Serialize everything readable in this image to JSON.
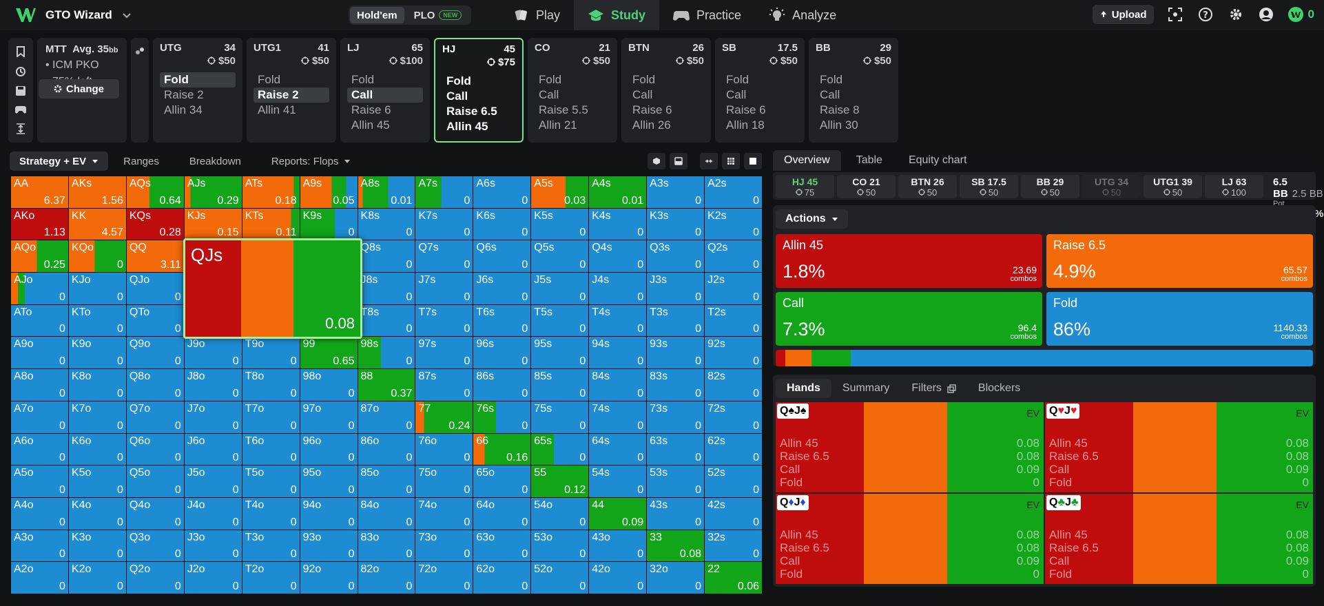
{
  "app": {
    "brand": "GTO Wizard"
  },
  "variant": {
    "holdem": "Hold'em",
    "plo": "PLO",
    "plo_badge": "NEW"
  },
  "nav": {
    "play": "Play",
    "study": "Study",
    "practice": "Practice",
    "analyze": "Analyze"
  },
  "top": {
    "upload": "Upload",
    "credits": "0"
  },
  "format": {
    "title": "MTT",
    "avg": "Avg. 35",
    "avg_unit": "bb",
    "line1": "• ICM PKO",
    "line2": "• 75% left",
    "change": "Change"
  },
  "seats": [
    {
      "pos": "UTG",
      "stack": "34",
      "bounty": "$50",
      "actions": [
        {
          "label": "Fold",
          "sel": true
        },
        {
          "label": "Raise 2",
          "sel": false
        },
        {
          "label": "Allin 34",
          "sel": false
        }
      ]
    },
    {
      "pos": "UTG1",
      "stack": "41",
      "bounty": "$50",
      "actions": [
        {
          "label": "Fold",
          "sel": false
        },
        {
          "label": "Raise 2",
          "sel": true
        },
        {
          "label": "Allin 41",
          "sel": false
        }
      ]
    },
    {
      "pos": "LJ",
      "stack": "65",
      "bounty": "$100",
      "actions": [
        {
          "label": "Fold",
          "sel": false
        },
        {
          "label": "Call",
          "sel": true
        },
        {
          "label": "Raise 6",
          "sel": false
        },
        {
          "label": "Allin 45",
          "sel": false
        }
      ]
    },
    {
      "pos": "HJ",
      "stack": "45",
      "bounty": "$75",
      "active": true,
      "actions": [
        {
          "label": "Fold",
          "sel": false
        },
        {
          "label": "Call",
          "sel": false
        },
        {
          "label": "Raise 6.5",
          "sel": false
        },
        {
          "label": "Allin 45",
          "sel": false
        }
      ]
    },
    {
      "pos": "CO",
      "stack": "21",
      "bounty": "$50",
      "actions": [
        {
          "label": "Fold",
          "sel": false
        },
        {
          "label": "Call",
          "sel": false
        },
        {
          "label": "Raise 5.5",
          "sel": false
        },
        {
          "label": "Allin 21",
          "sel": false
        }
      ]
    },
    {
      "pos": "BTN",
      "stack": "26",
      "bounty": "$50",
      "actions": [
        {
          "label": "Fold",
          "sel": false
        },
        {
          "label": "Call",
          "sel": false
        },
        {
          "label": "Raise 6",
          "sel": false
        },
        {
          "label": "Allin 26",
          "sel": false
        }
      ]
    },
    {
      "pos": "SB",
      "stack": "17.5",
      "bounty": "$50",
      "actions": [
        {
          "label": "Fold",
          "sel": false
        },
        {
          "label": "Call",
          "sel": false
        },
        {
          "label": "Raise 6",
          "sel": false
        },
        {
          "label": "Allin 18",
          "sel": false
        }
      ]
    },
    {
      "pos": "BB",
      "stack": "29",
      "bounty": "$50",
      "actions": [
        {
          "label": "Fold",
          "sel": false
        },
        {
          "label": "Call",
          "sel": false
        },
        {
          "label": "Raise 8",
          "sel": false
        },
        {
          "label": "Allin 30",
          "sel": false
        }
      ]
    }
  ],
  "left_tabs": {
    "strategy": "Strategy + EV",
    "ranges": "Ranges",
    "breakdown": "Breakdown",
    "reports": "Reports: Flops"
  },
  "colors": {
    "allin": "#bf0d0d",
    "raise": "#f26a0a",
    "call": "#12a51a",
    "fold": "#1e8cd2"
  },
  "grid": {
    "hands": [
      [
        "AA",
        "AKs",
        "AQs",
        "AJs",
        "ATs",
        "A9s",
        "A8s",
        "A7s",
        "A6s",
        "A5s",
        "A4s",
        "A3s",
        "A2s"
      ],
      [
        "AKo",
        "KK",
        "KQs",
        "KJs",
        "KTs",
        "K9s",
        "K8s",
        "K7s",
        "K6s",
        "K5s",
        "K4s",
        "K3s",
        "K2s"
      ],
      [
        "AQo",
        "KQo",
        "QQ",
        "QJs",
        "QTs",
        "Q9s",
        "Q8s",
        "Q7s",
        "Q6s",
        "Q5s",
        "Q4s",
        "Q3s",
        "Q2s"
      ],
      [
        "AJo",
        "KJo",
        "QJo",
        "JJ",
        "JTs",
        "J9s",
        "J8s",
        "J7s",
        "J6s",
        "J5s",
        "J4s",
        "J3s",
        "J2s"
      ],
      [
        "ATo",
        "KTo",
        "QTo",
        "JTo",
        "TT",
        "T9s",
        "T8s",
        "T7s",
        "T6s",
        "T5s",
        "T4s",
        "T3s",
        "T2s"
      ],
      [
        "A9o",
        "K9o",
        "Q9o",
        "J9o",
        "T9o",
        "99",
        "98s",
        "97s",
        "96s",
        "95s",
        "94s",
        "93s",
        "92s"
      ],
      [
        "A8o",
        "K8o",
        "Q8o",
        "J8o",
        "T8o",
        "98o",
        "88",
        "87s",
        "86s",
        "85s",
        "84s",
        "83s",
        "82s"
      ],
      [
        "A7o",
        "K7o",
        "Q7o",
        "J7o",
        "T7o",
        "97o",
        "87o",
        "77",
        "76s",
        "75s",
        "74s",
        "73s",
        "72s"
      ],
      [
        "A6o",
        "K6o",
        "Q6o",
        "J6o",
        "T6o",
        "96o",
        "86o",
        "76o",
        "66",
        "65s",
        "64s",
        "63s",
        "62s"
      ],
      [
        "A5o",
        "K5o",
        "Q5o",
        "J5o",
        "T5o",
        "95o",
        "85o",
        "75o",
        "65o",
        "55",
        "54s",
        "53s",
        "52s"
      ],
      [
        "A4o",
        "K4o",
        "Q4o",
        "J4o",
        "T4o",
        "94o",
        "84o",
        "74o",
        "64o",
        "54o",
        "44",
        "43s",
        "42s"
      ],
      [
        "A3o",
        "K3o",
        "Q3o",
        "J3o",
        "T3o",
        "93o",
        "83o",
        "73o",
        "63o",
        "53o",
        "43o",
        "33",
        "32s"
      ],
      [
        "A2o",
        "K2o",
        "Q2o",
        "J2o",
        "T2o",
        "92o",
        "82o",
        "72o",
        "62o",
        "52o",
        "42o",
        "32o",
        "22"
      ]
    ],
    "ev": [
      [
        "6.37",
        "1.56",
        "0.64",
        "0.29",
        "0.18",
        "0.05",
        "0.01",
        "0",
        "0",
        "0.03",
        "0.01",
        "0",
        "0"
      ],
      [
        "1.13",
        "4.57",
        "0.28",
        "0.15",
        "0.11",
        "0",
        "0",
        "0",
        "0",
        "0",
        "0",
        "0",
        "0"
      ],
      [
        "0.25",
        "0",
        "3.11",
        "",
        "0",
        "0",
        "0",
        "0",
        "0",
        "0",
        "0",
        "0",
        "0"
      ],
      [
        "0",
        "0",
        "0",
        "",
        "0",
        "0",
        "0",
        "0",
        "0",
        "0",
        "0",
        "0",
        "0"
      ],
      [
        "0",
        "0",
        "0",
        "0",
        "",
        "0",
        "0",
        "0",
        "0",
        "0",
        "0",
        "0",
        "0"
      ],
      [
        "0",
        "0",
        "0",
        "0",
        "0",
        "0.65",
        "0",
        "0",
        "0",
        "0",
        "0",
        "0",
        "0"
      ],
      [
        "0",
        "0",
        "0",
        "0",
        "0",
        "0",
        "0.37",
        "0",
        "0",
        "0",
        "0",
        "0",
        "0"
      ],
      [
        "0",
        "0",
        "0",
        "0",
        "0",
        "0",
        "0",
        "0.24",
        "0",
        "0",
        "0",
        "0",
        "0"
      ],
      [
        "0",
        "0",
        "0",
        "0",
        "0",
        "0",
        "0",
        "0",
        "0.16",
        "0",
        "0",
        "0",
        "0"
      ],
      [
        "0",
        "0",
        "0",
        "0",
        "0",
        "0",
        "0",
        "0",
        "0",
        "0.12",
        "0",
        "0",
        "0"
      ],
      [
        "0",
        "0",
        "0",
        "0",
        "0",
        "0",
        "0",
        "0",
        "0",
        "0",
        "0.09",
        "0",
        "0"
      ],
      [
        "0",
        "0",
        "0",
        "0",
        "0",
        "0",
        "0",
        "0",
        "0",
        "0",
        "0",
        "0.08",
        "0"
      ],
      [
        "0",
        "0",
        "0",
        "0",
        "0",
        "0",
        "0",
        "0",
        "0",
        "0",
        "0",
        "0",
        "0.06"
      ]
    ],
    "special": {
      "AA": [
        0,
        100,
        0,
        0
      ],
      "AKs": [
        0,
        100,
        0,
        0
      ],
      "AQs": [
        0,
        40,
        60,
        0
      ],
      "AJs": [
        0,
        10,
        90,
        0
      ],
      "ATs": [
        0,
        90,
        10,
        0
      ],
      "A9s": [
        0,
        55,
        25,
        20
      ],
      "A8s": [
        0,
        8,
        45,
        47
      ],
      "A7s": [
        0,
        0,
        45,
        55
      ],
      "A5s": [
        0,
        60,
        40,
        0
      ],
      "A4s": [
        0,
        0,
        100,
        0
      ],
      "AKo": [
        100,
        0,
        0,
        0
      ],
      "KK": [
        0,
        100,
        0,
        0
      ],
      "KQs": [
        100,
        0,
        0,
        0
      ],
      "KJs": [
        0,
        100,
        0,
        0
      ],
      "KTs": [
        0,
        85,
        15,
        0
      ],
      "K9s": [
        0,
        0,
        60,
        40
      ],
      "AQo": [
        0,
        45,
        55,
        0
      ],
      "KQo": [
        0,
        45,
        55,
        0
      ],
      "QQ": [
        0,
        100,
        0,
        0
      ],
      "AJo": [
        0,
        12,
        12,
        76
      ],
      "99": [
        0,
        0,
        100,
        0
      ],
      "98s": [
        0,
        0,
        40,
        60
      ],
      "88": [
        0,
        0,
        100,
        0
      ],
      "77": [
        0,
        15,
        85,
        0
      ],
      "76s": [
        0,
        0,
        40,
        60
      ],
      "66": [
        0,
        20,
        80,
        0
      ],
      "65s": [
        0,
        0,
        40,
        60
      ],
      "55": [
        0,
        0,
        100,
        0
      ],
      "44": [
        0,
        0,
        100,
        0
      ],
      "33": [
        0,
        0,
        100,
        0
      ],
      "22": [
        0,
        0,
        100,
        0
      ]
    }
  },
  "zoom": {
    "hand": "QJs",
    "ev": "0.08",
    "allin": 32,
    "raise": 30,
    "call": 38
  },
  "right_tabs": {
    "overview": "Overview",
    "table": "Table",
    "equity": "Equity chart"
  },
  "stacks": [
    {
      "name": "HJ 45",
      "bounty": "75",
      "hl": true
    },
    {
      "name": "CO 21",
      "bounty": "50"
    },
    {
      "name": "BTN 26",
      "bounty": "50"
    },
    {
      "name": "SB 17.5",
      "bounty": "50"
    },
    {
      "name": "BB 29",
      "bounty": "50"
    },
    {
      "name": "UTG 34",
      "bounty": "50",
      "dim": true
    },
    {
      "name": "UTG1 39",
      "bounty": "50"
    },
    {
      "name": "LJ 63",
      "bounty": "100"
    }
  ],
  "pot": {
    "bb": "6.5 BB",
    "bb2": "2.5 BB",
    "odds_label": "Pot odds:",
    "odds": "23.5%"
  },
  "actions": {
    "label": "Actions",
    "allin": {
      "name": "Allin 45",
      "pct": "1.8%",
      "combos": "23.69",
      "combos_label": "combos"
    },
    "raise": {
      "name": "Raise 6.5",
      "pct": "4.9%",
      "combos": "65.57",
      "combos_label": "combos"
    },
    "call": {
      "name": "Call",
      "pct": "7.3%",
      "combos": "96.4",
      "combos_label": "combos"
    },
    "fold": {
      "name": "Fold",
      "pct": "86%",
      "combos": "1140.33",
      "combos_label": "combos"
    },
    "bar": [
      1.8,
      4.9,
      7.3,
      86
    ]
  },
  "hands_tabs": {
    "hands": "Hands",
    "summary": "Summary",
    "filters": "Filters",
    "blockers": "Blockers"
  },
  "combos": [
    {
      "r1": "Q",
      "s1": "♠",
      "c1": "r",
      "r2": "J",
      "s2": "♠",
      "c2": "r",
      "ev_label": "EV",
      "lines": [
        [
          "Allin 45",
          "0.08"
        ],
        [
          "Raise 6.5",
          "0.08"
        ],
        [
          "Call",
          "0.09"
        ],
        [
          "Fold",
          "0"
        ]
      ]
    },
    {
      "r1": "Q",
      "s1": "♥",
      "c1": "red",
      "r2": "J",
      "s2": "♥",
      "c2": "red",
      "ev_label": "EV",
      "lines": [
        [
          "Allin 45",
          "0.08"
        ],
        [
          "Raise 6.5",
          "0.08"
        ],
        [
          "Call",
          "0.09"
        ],
        [
          "Fold",
          "0"
        ]
      ]
    },
    {
      "r1": "Q",
      "s1": "♦",
      "c1": "blu",
      "r2": "J",
      "s2": "♦",
      "c2": "blu",
      "ev_label": "EV",
      "lines": [
        [
          "Allin 45",
          "0.08"
        ],
        [
          "Raise 6.5",
          "0.08"
        ],
        [
          "Call",
          "0.09"
        ],
        [
          "Fold",
          "0"
        ]
      ]
    },
    {
      "r1": "Q",
      "s1": "♣",
      "c1": "grn",
      "r2": "J",
      "s2": "♣",
      "c2": "grn",
      "ev_label": "EV",
      "lines": [
        [
          "Allin 45",
          "0.08"
        ],
        [
          "Raise 6.5",
          "0.08"
        ],
        [
          "Call",
          "0.09"
        ],
        [
          "Fold",
          "0"
        ]
      ]
    }
  ]
}
